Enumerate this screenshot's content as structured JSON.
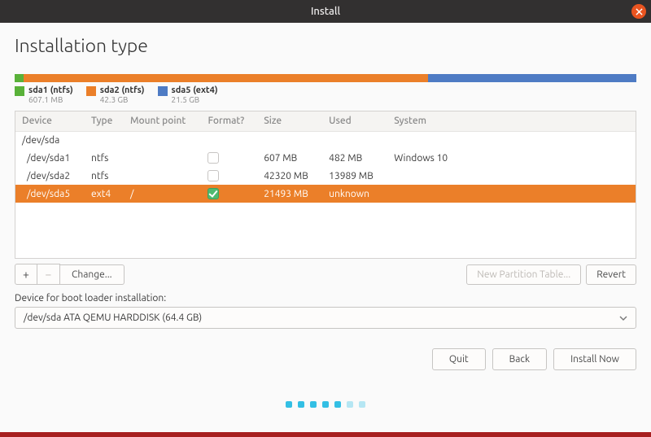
{
  "window": {
    "title": "Install"
  },
  "heading": "Installation type",
  "usage_segments": [
    {
      "cls": "g",
      "pct": 1.5
    },
    {
      "cls": "o",
      "pct": 65.0
    },
    {
      "cls": "b",
      "pct": 33.5
    }
  ],
  "legend": [
    {
      "cls": "g",
      "name": "sda1 (ntfs)",
      "sub": "607.1 MB"
    },
    {
      "cls": "o",
      "name": "sda2 (ntfs)",
      "sub": "42.3 GB"
    },
    {
      "cls": "b",
      "name": "sda5 (ext4)",
      "sub": "21.5 GB"
    }
  ],
  "cols": {
    "device": "Device",
    "type": "Type",
    "mount": "Mount point",
    "format": "Format?",
    "size": "Size",
    "used": "Used",
    "system": "System"
  },
  "rows": [
    {
      "device": "/dev/sda",
      "type": "",
      "mount": "",
      "format": null,
      "size": "",
      "used": "",
      "system": "",
      "sel": false,
      "indent": 0
    },
    {
      "device": "/dev/sda1",
      "type": "ntfs",
      "mount": "",
      "format": false,
      "size": "607 MB",
      "used": "482 MB",
      "system": "Windows 10",
      "sel": false,
      "indent": 1
    },
    {
      "device": "/dev/sda2",
      "type": "ntfs",
      "mount": "",
      "format": false,
      "size": "42320 MB",
      "used": "13989 MB",
      "system": "",
      "sel": false,
      "indent": 1
    },
    {
      "device": "/dev/sda5",
      "type": "ext4",
      "mount": "/",
      "format": true,
      "size": "21493 MB",
      "used": "unknown",
      "system": "",
      "sel": true,
      "indent": 1
    }
  ],
  "toolbar": {
    "add": "+",
    "remove": "−",
    "change": "Change...",
    "npt": "New Partition Table...",
    "revert": "Revert"
  },
  "boot": {
    "label": "Device for boot loader installation:",
    "selected": "/dev/sda   ATA QEMU HARDDISK (64.4 GB)"
  },
  "nav": {
    "quit": "Quit",
    "back": "Back",
    "install": "Install Now"
  },
  "progress": {
    "total": 7,
    "current": 5
  }
}
